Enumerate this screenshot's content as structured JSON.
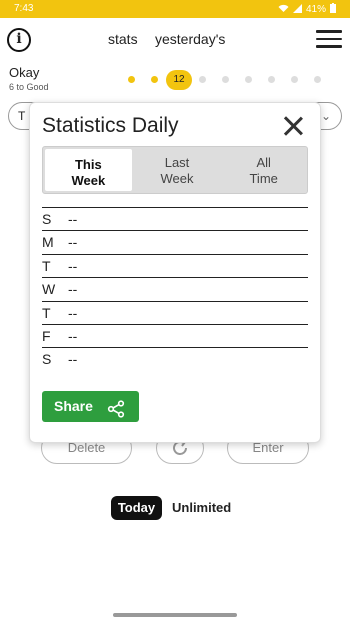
{
  "status_bar": {
    "time": "7:43",
    "battery": "41%"
  },
  "header": {
    "stats_label": "stats",
    "yesterdays_label": "yesterday's"
  },
  "level": {
    "title": "Okay",
    "subtitle": "6 to Good",
    "current": "12"
  },
  "background": {
    "select_value": "T",
    "buttons": {
      "delete": "Delete",
      "enter": "Enter"
    }
  },
  "footer": {
    "today": "Today",
    "unlimited": "Unlimited"
  },
  "dialog": {
    "title": "Statistics Daily",
    "tabs": [
      {
        "line1": "This",
        "line2": "Week"
      },
      {
        "line1": "Last",
        "line2": "Week"
      },
      {
        "line1": "All",
        "line2": "Time"
      }
    ],
    "rows": [
      {
        "day": "S",
        "value": "--"
      },
      {
        "day": "M",
        "value": "--"
      },
      {
        "day": "T",
        "value": "--"
      },
      {
        "day": "W",
        "value": "--"
      },
      {
        "day": "T",
        "value": "--"
      },
      {
        "day": "F",
        "value": "--"
      },
      {
        "day": "S",
        "value": "--"
      }
    ],
    "share_label": "Share"
  },
  "colors": {
    "accent": "#f2c40f",
    "share": "#2e9e3e"
  }
}
